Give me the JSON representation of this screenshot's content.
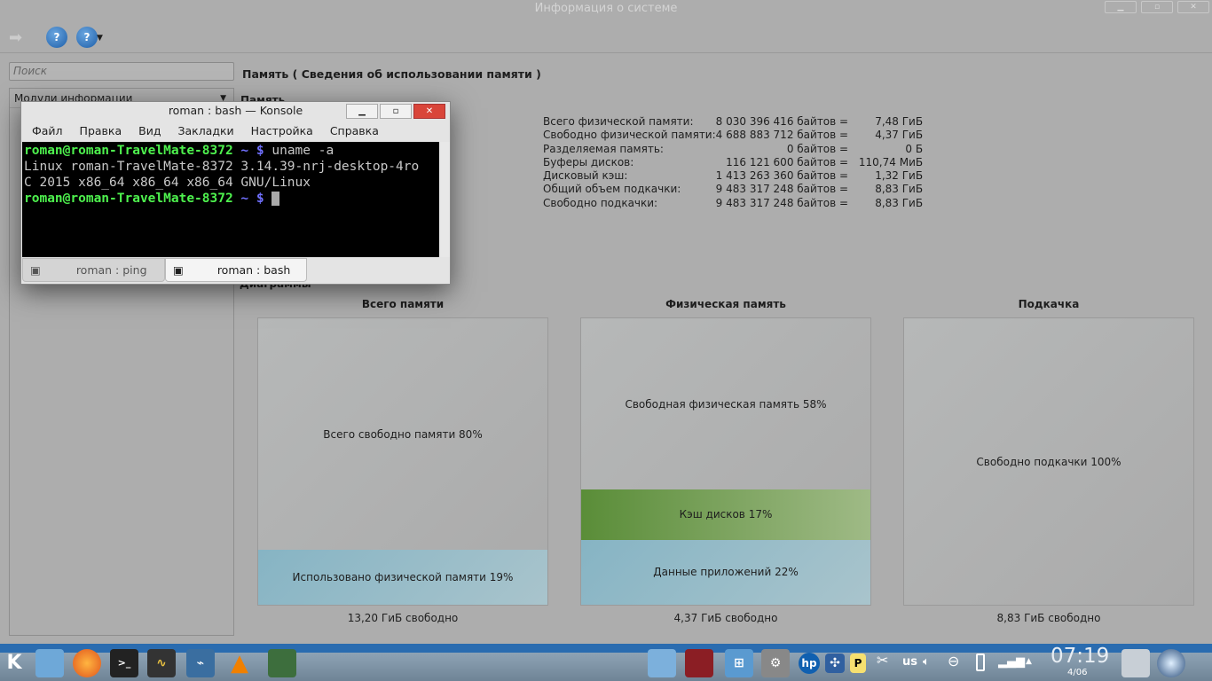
{
  "window": {
    "title": "Информация о системе"
  },
  "toolbar": {
    "help1": "?",
    "help2": "?"
  },
  "sidebar": {
    "search_placeholder": "Поиск",
    "modules_label": "Модули информации"
  },
  "main": {
    "title": "Память  ( Сведения об использовании памяти )",
    "section_memory": "Память",
    "section_charts": "Диаграммы",
    "rows": [
      {
        "label": "Всего физической памяти:",
        "bytes": "8 030 396 416 байтов =",
        "value": "7,48 ГиБ"
      },
      {
        "label": "Свободно физической памяти:",
        "bytes": "4 688 883 712 байтов =",
        "value": "4,37 ГиБ"
      },
      {
        "label": "Разделяемая память:",
        "bytes": "0 байтов =",
        "value": "0 Б"
      },
      {
        "label": "Буферы дисков:",
        "bytes": "116 121 600 байтов =",
        "value": "110,74 МиБ"
      },
      {
        "label": "Дисковый кэш:",
        "bytes": "1 413 263 360 байтов =",
        "value": "1,32 ГиБ"
      },
      {
        "label": "",
        "bytes": "",
        "value": ""
      },
      {
        "label": "Общий объем подкачки:",
        "bytes": "9 483 317 248 байтов =",
        "value": "8,83 ГиБ"
      },
      {
        "label": "Свободно подкачки:",
        "bytes": "9 483 317 248 байтов =",
        "value": "8,83 ГиБ"
      }
    ],
    "charts": [
      {
        "title": "Всего памяти",
        "footer": "13,20 ГиБ свободно",
        "segments": [
          {
            "label": "Всего свободно памяти 80%",
            "percent": 80
          },
          {
            "label": "Использовано физической памяти 19%",
            "percent": 19,
            "color": "#86b4c4"
          }
        ]
      },
      {
        "title": "Физическая память",
        "footer": "4,37 ГиБ свободно",
        "segments": [
          {
            "label": "Свободная физическая память 58%",
            "percent": 58
          },
          {
            "label": "Кэш дисков 17%",
            "percent": 17,
            "color": "#6fa04c"
          },
          {
            "label": "Данные приложений 22%",
            "percent": 22,
            "color": "#86b4c4"
          }
        ]
      },
      {
        "title": "Подкачка",
        "footer": "8,83 ГиБ свободно",
        "segments": [
          {
            "label": "Свободно подкачки 100%",
            "percent": 100
          }
        ]
      }
    ]
  },
  "konsole": {
    "title": "roman : bash — Konsole",
    "menu": [
      "Файл",
      "Правка",
      "Вид",
      "Закладки",
      "Настройка",
      "Справка"
    ],
    "prompt": "roman@roman-TravelMate-8372",
    "tilde": " ~ $ ",
    "command": "uname -a",
    "output1": "Linux roman-TravelMate-8372 3.14.39-nrj-desktop-4ro",
    "output2": "C 2015 x86_64 x86_64 x86_64 GNU/Linux",
    "tabs": [
      "roman : ping",
      "roman : bash"
    ]
  },
  "taskbar": {
    "kbd_layout": "us",
    "clock": "07:19",
    "date": "4/06"
  }
}
